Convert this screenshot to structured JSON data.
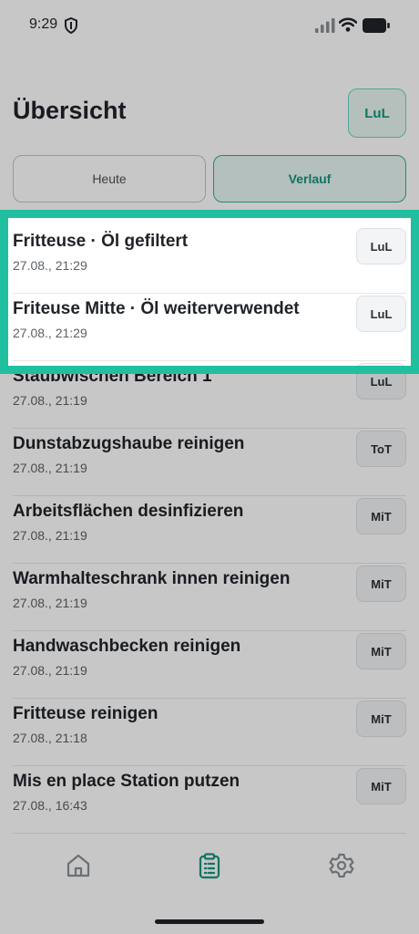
{
  "status_bar": {
    "time": "9:29",
    "icons": [
      "shield-icon",
      "signal-icon",
      "wifi-icon",
      "battery-icon"
    ]
  },
  "header": {
    "title": "Übersicht",
    "user_initials": "LuL"
  },
  "tabs": [
    {
      "label": "Heute",
      "active": false
    },
    {
      "label": "Verlauf",
      "active": true
    }
  ],
  "entries": [
    {
      "title": "Fritteuse · Öl gefiltert",
      "time": "27.08., 21:29",
      "user": "LuL"
    },
    {
      "title": "Friteuse Mitte · Öl weiterverwendet",
      "time": "27.08., 21:29",
      "user": "LuL"
    },
    {
      "title": "Staubwischen Bereich 1",
      "time": "27.08., 21:19",
      "user": "LuL"
    },
    {
      "title": "Dunstabzugshaube reinigen",
      "time": "27.08., 21:19",
      "user": "ToT"
    },
    {
      "title": "Arbeitsflächen desinfizieren",
      "time": "27.08., 21:19",
      "user": "MiT"
    },
    {
      "title": "Warmhalteschrank innen reinigen",
      "time": "27.08., 21:19",
      "user": "MiT"
    },
    {
      "title": "Handwaschbecken reinigen",
      "time": "27.08., 21:19",
      "user": "MiT"
    },
    {
      "title": "Fritteuse reinigen",
      "time": "27.08., 21:18",
      "user": "MiT"
    },
    {
      "title": "Mis en place Station putzen",
      "time": "27.08., 16:43",
      "user": "MiT"
    }
  ],
  "bottom_nav": [
    {
      "icon": "home-icon",
      "active": false
    },
    {
      "icon": "clipboard-icon",
      "active": true
    },
    {
      "icon": "gear-icon",
      "active": false
    }
  ],
  "colors": {
    "accent": "#14957f",
    "highlight": "#1fbfa0",
    "accent_bg": "#e6f6f2"
  }
}
